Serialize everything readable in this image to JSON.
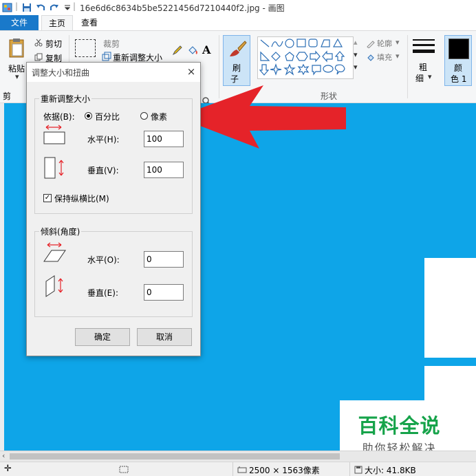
{
  "window": {
    "title": "16e6d6c8634b5be5221456d7210440f2.jpg - 画图"
  },
  "tabs": {
    "file": "文件",
    "home": "主页",
    "view": "查看"
  },
  "ribbon": {
    "paste": "粘贴",
    "cut": "剪切",
    "copy": "复制",
    "crop": "裁剪",
    "resize": "重新调整大小",
    "brush_top": "刷",
    "brush_bottom": "子",
    "outline": "轮廓",
    "fill": "填充",
    "shapes_group": "形状",
    "size_top": "粗",
    "size_bottom": "细",
    "color_top": "颜",
    "color_bottom": "色 1",
    "clipboard_fragment": "剪"
  },
  "dialog": {
    "title": "调整大小和扭曲",
    "close": "×",
    "resize_group": "重新调整大小",
    "by_label": "依据(B):",
    "percent": "百分比",
    "pixels": "像素",
    "horizontal_label": "水平(H):",
    "horizontal_value": "100",
    "vertical_label": "垂直(V):",
    "vertical_value": "100",
    "keep_ratio": "保持纵横比(M)",
    "skew_group": "倾斜(角度)",
    "skew_h_label": "水平(O):",
    "skew_h_value": "0",
    "skew_v_label": "垂直(E):",
    "skew_v_value": "0",
    "ok": "确定",
    "cancel": "取消"
  },
  "status": {
    "image_size": "2500 × 1563像素",
    "file_size": "大小: 41.8KB"
  },
  "watermark": {
    "title": "百科全说",
    "subtitle": "助你轻松解决"
  },
  "colors": {
    "canvas": "#0ea5e8",
    "file_tab": "#1979ca",
    "arrow": "#e52329",
    "watermark": "#16a34a"
  }
}
